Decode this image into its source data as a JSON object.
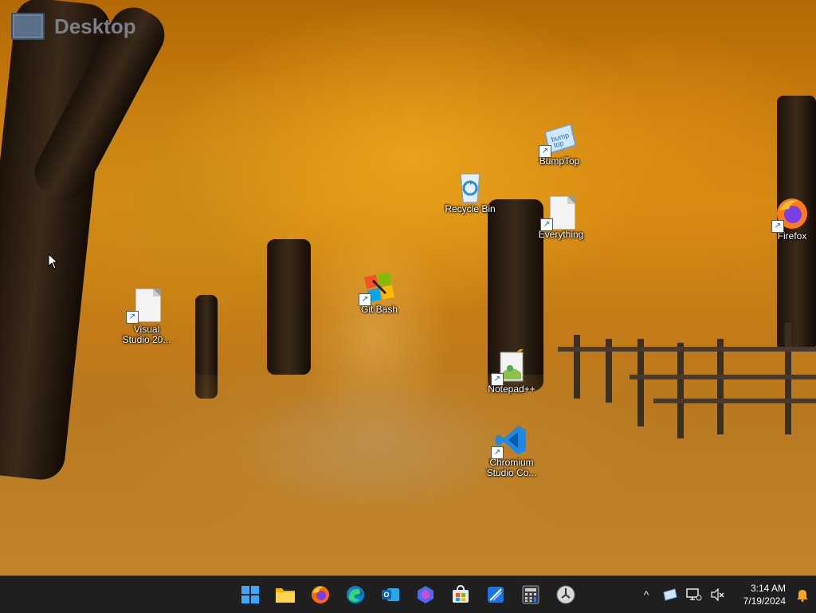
{
  "desktop": {
    "title": "Desktop",
    "icons": {
      "bumptop": "BumpTop",
      "recycle_bin": "Recycle Bin",
      "everything": "Everything",
      "firefox": "Firefox",
      "git_bash": "Git Bash",
      "visual_studio": "Visual Studio 20...",
      "notepadpp": "Notepad++",
      "vscode_line1": "Chromium",
      "vscode_line2": "Studio Co..."
    }
  },
  "taskbar": {
    "apps": [
      "start-icon",
      "file-explorer-icon",
      "firefox-icon",
      "edge-icon",
      "outlook-icon",
      "copilot-icon",
      "store-icon",
      "snipping-tool-icon",
      "calculator-icon",
      "clock-app-icon"
    ],
    "tray": {
      "chevron": "^",
      "time": "3:14 AM",
      "date": "7/19/2024"
    }
  },
  "colors": {
    "taskbar_bg": "#1f1f1f",
    "accent_blue": "#0078d4"
  }
}
